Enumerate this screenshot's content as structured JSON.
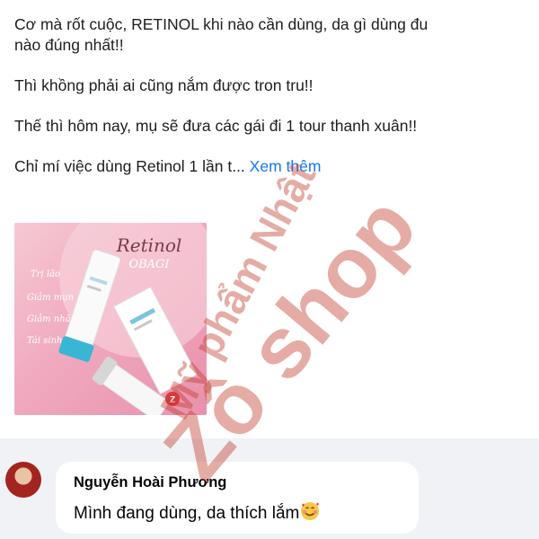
{
  "post": {
    "paragraphs": [
      "Cơ mà rốt cuộc, RETINOL khi nào cần dùng, da gì dùng đu",
      "nào đúng nhất!!",
      "Thì khồng phải ai cũng nắm được tron tru!!",
      "Thế thì hôm nay, mụ sẽ đưa các gái đi 1 tour thanh xuân!!",
      "Chỉ mí việc dùng Retinol 1 lần t..."
    ],
    "see_more": "Xem thêm",
    "image": {
      "title": "Retinol",
      "subtitle": "OBAGI",
      "side_notes": [
        "Trị lão",
        "Giảm mụn",
        "Giảm nhăn",
        "Tái sinh da dẻ"
      ]
    }
  },
  "comment": {
    "author": "Nguyễn Hoài Phương",
    "text": "Mình đang dùng, da thích lắm",
    "emoji_icon": "smiling-face-with-hearts"
  },
  "watermark": {
    "line1": "Mỹ phẩm Nhật",
    "line2": "Zô shop"
  },
  "colors": {
    "link": "#1877f2",
    "comment_bg": "#f0f2f5",
    "watermark": "#c0392b"
  }
}
